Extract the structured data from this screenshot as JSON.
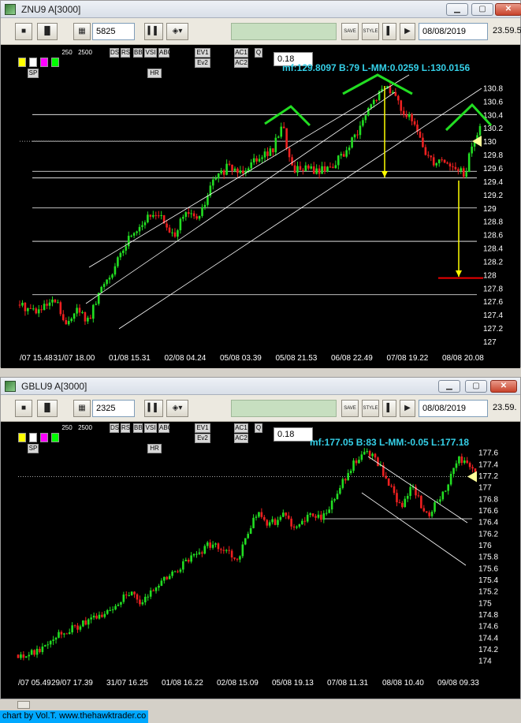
{
  "credit": "chart by Vol.T. www.thehawktrader.co",
  "colors": {
    "bull": "#22dd22",
    "bear": "#ee2020",
    "grid": "#ffffff",
    "annot_green": "#22dd22",
    "arrow_yellow": "#ffff00",
    "target_red": "#ee0000",
    "info": "#35d0e8"
  },
  "windows": [
    {
      "title": "ZNU9 A[3000]",
      "bars_field": "5825",
      "date_field": "08/08/2019",
      "time_text": "23.59.5",
      "toolbar": {
        "save_label": "SAVE",
        "style_label": "STYLE",
        "play_label": "▶"
      },
      "input_value": "0.18",
      "info_text": "mf:129.8097 B:79 L-MM:0.0259 L:130.0156",
      "ind_labels": [
        "250",
        "2500",
        "DS",
        "RS",
        "BB",
        "VSI",
        "ABC",
        "EV1",
        "AC1",
        "Q",
        "HR",
        "Ev2",
        "AC2",
        "SP"
      ],
      "chart_data": {
        "type": "candlestick",
        "ylim": [
          127.0,
          130.9
        ],
        "y_ticks": [
          "130.8",
          "130.6",
          "130.4",
          "130.2",
          "130",
          "129.8",
          "129.6",
          "129.4",
          "129.2",
          "129",
          "128.8",
          "128.6",
          "128.4",
          "128.2",
          "128",
          "127.8",
          "127.6",
          "127.4",
          "127.2",
          "127"
        ],
        "x_ticks": [
          "/07 15.48",
          "31/07 18.00",
          "01/08 15.31",
          "02/08 04.24",
          "05/08 03.39",
          "05/08 21.53",
          "06/08 22.49",
          "07/08 19.22",
          "08/08 20.08"
        ],
        "path": [
          [
            0,
            127.55
          ],
          [
            0.04,
            127.45
          ],
          [
            0.08,
            127.6
          ],
          [
            0.1,
            127.2
          ],
          [
            0.12,
            127.5
          ],
          [
            0.15,
            127.3
          ],
          [
            0.18,
            127.85
          ],
          [
            0.21,
            128.15
          ],
          [
            0.24,
            128.6
          ],
          [
            0.27,
            128.8
          ],
          [
            0.3,
            128.95
          ],
          [
            0.33,
            128.55
          ],
          [
            0.36,
            128.9
          ],
          [
            0.39,
            128.85
          ],
          [
            0.42,
            129.4
          ],
          [
            0.45,
            129.6
          ],
          [
            0.48,
            129.55
          ],
          [
            0.52,
            129.8
          ],
          [
            0.55,
            129.85
          ],
          [
            0.57,
            130.3
          ],
          [
            0.59,
            129.6
          ],
          [
            0.62,
            129.6
          ],
          [
            0.65,
            129.55
          ],
          [
            0.68,
            129.65
          ],
          [
            0.71,
            129.85
          ],
          [
            0.74,
            130.2
          ],
          [
            0.76,
            130.5
          ],
          [
            0.78,
            130.7
          ],
          [
            0.8,
            130.85
          ],
          [
            0.82,
            130.6
          ],
          [
            0.84,
            130.4
          ],
          [
            0.86,
            130.2
          ],
          [
            0.88,
            129.85
          ],
          [
            0.9,
            129.7
          ],
          [
            0.92,
            129.75
          ],
          [
            0.94,
            129.6
          ],
          [
            0.96,
            129.55
          ],
          [
            0.97,
            129.5
          ],
          [
            0.98,
            129.9
          ],
          [
            1.0,
            130.2
          ]
        ],
        "hlines": [
          130.4,
          130.0,
          129.55,
          129.45,
          129.0,
          128.5,
          127.7
        ],
        "target_line": 127.95,
        "current_price": 130.0
      }
    },
    {
      "title": "GBLU9 A[3000]",
      "bars_field": "2325",
      "date_field": "08/08/2019",
      "time_text": "23.59.",
      "toolbar": {
        "save_label": "SAVE",
        "style_label": "STYLE",
        "play_label": "▶"
      },
      "input_value": "0.18",
      "info_text": "mf:177.05 B:83 L-MM:-0.05 L:177.18",
      "ind_labels": [
        "250",
        "2500",
        "DS",
        "RS",
        "BB",
        "VSI",
        "ABC",
        "EV1",
        "AC1",
        "Q",
        "HR",
        "Ev2",
        "AC2",
        "SP"
      ],
      "chart_data": {
        "type": "candlestick",
        "ylim": [
          173.9,
          177.8
        ],
        "y_ticks": [
          "177.6",
          "177.4",
          "177.2",
          "177",
          "176.8",
          "176.6",
          "176.4",
          "176.2",
          "176",
          "175.8",
          "175.6",
          "175.4",
          "175.2",
          "175",
          "174.8",
          "174.6",
          "174.4",
          "174.2",
          "174"
        ],
        "x_ticks": [
          "/07 05.49",
          "29/07 17.39",
          "31/07 16.25",
          "01/08 16.22",
          "02/08 15.09",
          "05/08 19.13",
          "07/08 11.31",
          "08/08 10.40",
          "09/08 09.33"
        ],
        "path": [
          [
            0,
            174.1
          ],
          [
            0.04,
            174.15
          ],
          [
            0.08,
            174.45
          ],
          [
            0.12,
            174.55
          ],
          [
            0.16,
            174.7
          ],
          [
            0.2,
            174.85
          ],
          [
            0.24,
            175.2
          ],
          [
            0.27,
            174.95
          ],
          [
            0.3,
            175.3
          ],
          [
            0.33,
            175.45
          ],
          [
            0.36,
            175.65
          ],
          [
            0.39,
            175.85
          ],
          [
            0.42,
            176.0
          ],
          [
            0.45,
            175.95
          ],
          [
            0.48,
            175.75
          ],
          [
            0.52,
            176.55
          ],
          [
            0.55,
            176.35
          ],
          [
            0.58,
            176.5
          ],
          [
            0.61,
            176.3
          ],
          [
            0.64,
            176.5
          ],
          [
            0.67,
            176.5
          ],
          [
            0.7,
            176.9
          ],
          [
            0.72,
            177.25
          ],
          [
            0.74,
            177.45
          ],
          [
            0.76,
            177.6
          ],
          [
            0.78,
            177.5
          ],
          [
            0.8,
            177.2
          ],
          [
            0.82,
            176.9
          ],
          [
            0.84,
            176.6
          ],
          [
            0.86,
            177.1
          ],
          [
            0.88,
            176.7
          ],
          [
            0.9,
            176.5
          ],
          [
            0.92,
            176.8
          ],
          [
            0.94,
            177.0
          ],
          [
            0.96,
            177.5
          ],
          [
            0.98,
            177.4
          ],
          [
            1.0,
            177.2
          ]
        ],
        "hlines": [
          176.45
        ],
        "current_price": 177.18
      }
    }
  ]
}
